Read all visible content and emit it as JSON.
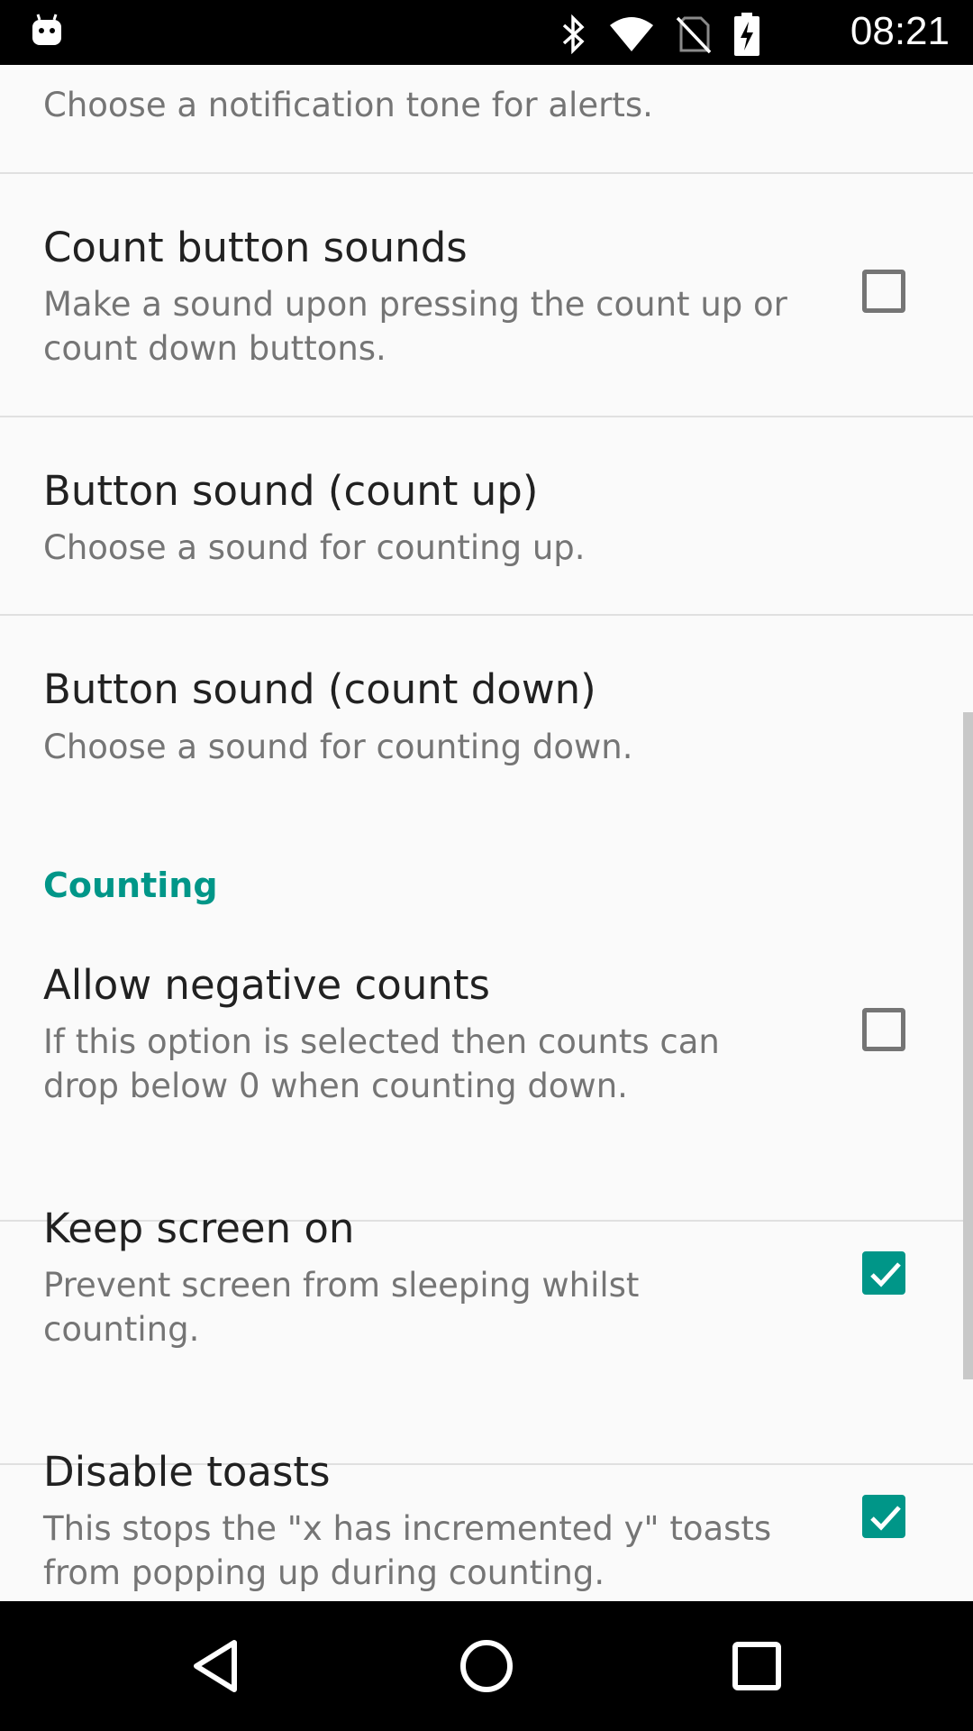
{
  "status_bar": {
    "time": "08:21",
    "icons": [
      "android-icon",
      "bluetooth-icon",
      "wifi-icon",
      "no-sim-icon",
      "battery-charging-icon"
    ]
  },
  "preferences": {
    "notification_tone": {
      "summary": "Choose a notification tone for alerts."
    },
    "count_button_sounds": {
      "title": "Count button sounds",
      "summary": "Make a sound upon pressing the count up or count down buttons.",
      "checked": false
    },
    "button_sound_up": {
      "title": "Button sound (count up)",
      "summary": "Choose a sound for counting up."
    },
    "button_sound_down": {
      "title": "Button sound (count down)",
      "summary": "Choose a sound for counting down."
    },
    "counting_category": "Counting",
    "allow_negative": {
      "title": "Allow negative counts",
      "summary": "If this option is selected then counts can drop below 0 when counting down.",
      "checked": false
    },
    "keep_screen_on": {
      "title": "Keep screen on",
      "summary": "Prevent screen from sleeping whilst counting.",
      "checked": true
    },
    "disable_toasts": {
      "title": "Disable toasts",
      "summary": "This stops the \"x has incremented y\" toasts from popping up during counting.",
      "checked": true
    }
  },
  "nav_bar": {
    "icons": [
      "back-icon",
      "home-icon",
      "recents-icon"
    ]
  },
  "colors": {
    "accent": "#009688",
    "title_text": "#212121",
    "summary_text": "#757575",
    "background": "#fafafa"
  }
}
